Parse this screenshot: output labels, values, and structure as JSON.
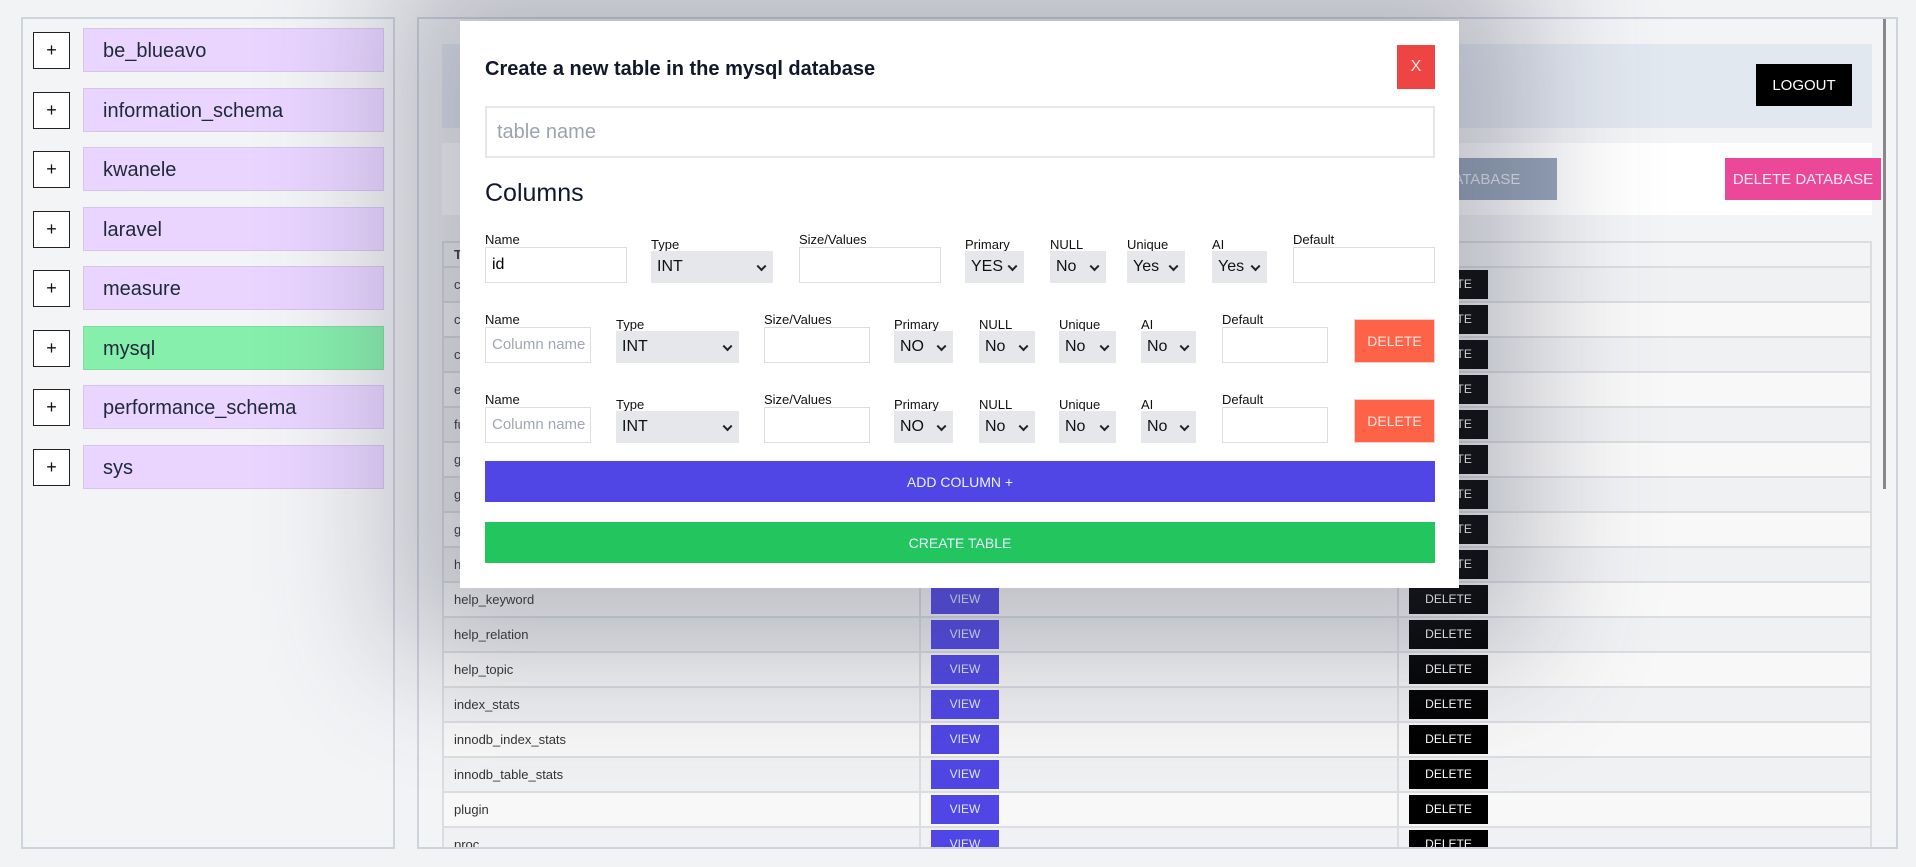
{
  "sidebar": {
    "plus_label": "+",
    "databases": [
      "be_blueavo",
      "information_schema",
      "kwanele",
      "laravel",
      "measure",
      "mysql",
      "performance_schema",
      "sys"
    ],
    "active": "mysql"
  },
  "header": {
    "logout_label": "LOGOUT"
  },
  "actions": {
    "grey_button_label": "CREATE DATABASE",
    "delete_database_label": "DELETE DATABASE"
  },
  "table": {
    "header": "Tables",
    "view_label": "VIEW",
    "delete_label": "DELETE",
    "rows": [
      "column_stats",
      "columns_priv",
      "component",
      "engine_cost",
      "func",
      "general_log",
      "global_grants",
      "gtid_executed",
      "help_category",
      "help_keyword",
      "help_relation",
      "help_topic",
      "index_stats",
      "innodb_index_stats",
      "innodb_table_stats",
      "plugin",
      "proc"
    ]
  },
  "modal": {
    "title": "Create a new table in the mysql database",
    "close_label": "X",
    "table_name_placeholder": "table name",
    "table_name_value": "",
    "columns_heading": "Columns",
    "labels": {
      "name": "Name",
      "type": "Type",
      "size": "Size/Values",
      "primary": "Primary",
      "null": "NULL",
      "unique": "Unique",
      "ai": "AI",
      "default": "Default"
    },
    "name_placeholder": "Column name",
    "column_rows": [
      {
        "name": "id",
        "type": "INT",
        "size": "",
        "primary": "YES",
        "null": "No",
        "unique": "Yes",
        "ai": "Yes",
        "default": "",
        "deletable": false
      },
      {
        "name": "",
        "type": "INT",
        "size": "",
        "primary": "NO",
        "null": "No",
        "unique": "No",
        "ai": "No",
        "default": "",
        "deletable": true
      },
      {
        "name": "",
        "type": "INT",
        "size": "",
        "primary": "NO",
        "null": "No",
        "unique": "No",
        "ai": "No",
        "default": "",
        "deletable": true
      }
    ],
    "delete_column_label": "DELETE",
    "add_column_label": "ADD COLUMN +",
    "create_table_label": "CREATE TABLE"
  },
  "colors": {
    "add_column": "#4f46e5",
    "create_table": "#22c55e",
    "close": "#ef4444",
    "delete_column": "#ff6347",
    "delete_database": "#ec4899",
    "active_db": "#86efac",
    "db_item": "#e9d5ff"
  }
}
